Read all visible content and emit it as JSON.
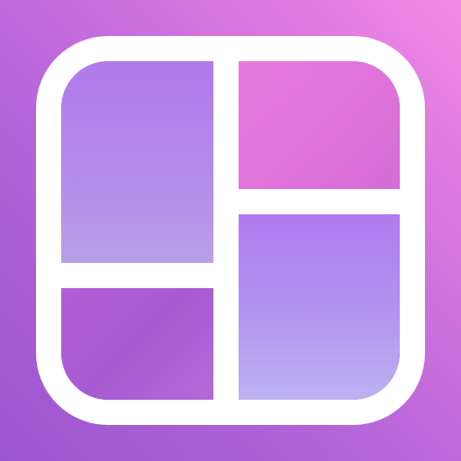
{
  "app_icon": {
    "icon": "collage-grid-icon",
    "colors": {
      "background_start": "#9b55cf",
      "background_end": "#f28ae6",
      "frame": "#ffffff",
      "tile_lavender": "#b58aea",
      "tile_violet": "#a85ad2",
      "tile_pink": "#df72da",
      "tile_periwinkle": "#b292ef"
    }
  }
}
